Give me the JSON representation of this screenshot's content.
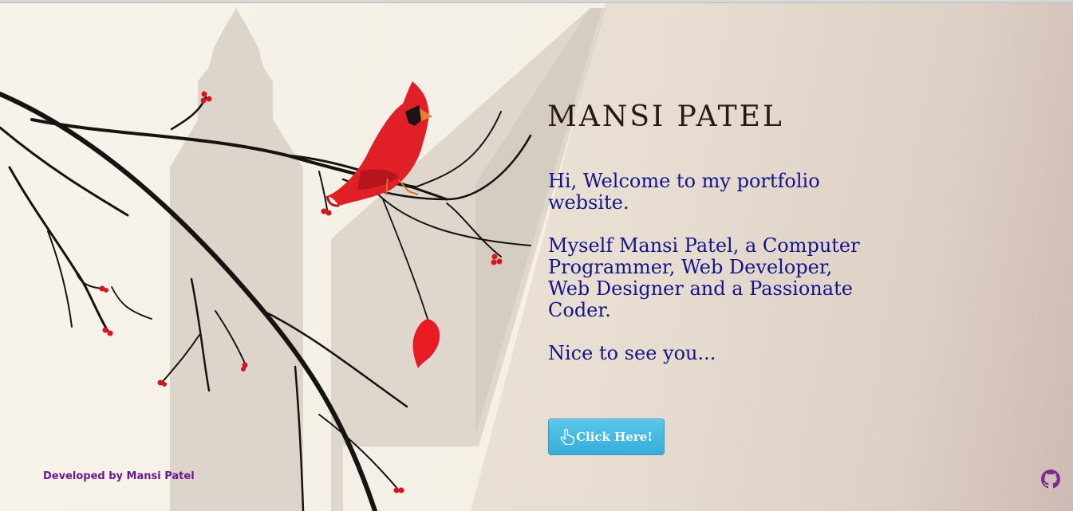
{
  "page": {
    "title": "MANSI PATEL",
    "intro_paragraphs": [
      "Hi, Welcome to my portfolio website.",
      "Myself Mansi Patel, a Computer Programmer, Web Developer, Web Designer and a Passionate Coder.",
      "Nice to see you..."
    ],
    "cta": {
      "label": "Click Here!",
      "icon": "hand-pointer-icon"
    }
  },
  "footer": {
    "credit": "Developed by Mansi Patel",
    "github_icon": "github-icon"
  },
  "colors": {
    "title_text": "#2a1812",
    "body_text": "#14148a",
    "button_bg": "#3fb4e0",
    "credit_text": "#6a1a8a",
    "cardinal": "#e01f26",
    "berries": "#d8141e",
    "github": "#7a2c8f"
  }
}
